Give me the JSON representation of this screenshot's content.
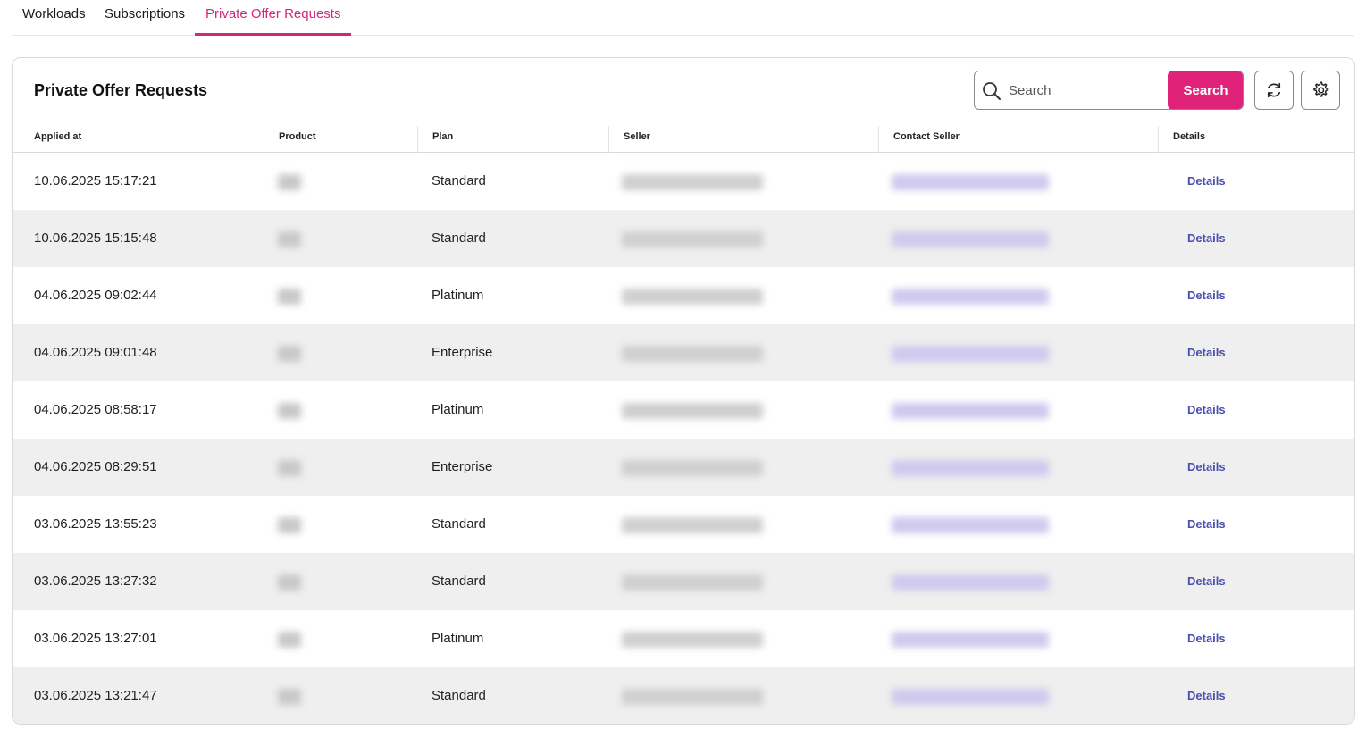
{
  "tabs": [
    {
      "label": "Workloads",
      "active": false
    },
    {
      "label": "Subscriptions",
      "active": false
    },
    {
      "label": "Private Offer Requests",
      "active": true
    }
  ],
  "card": {
    "title": "Private Offer Requests",
    "search": {
      "placeholder": "Search",
      "value": "",
      "button_label": "Search"
    },
    "refresh_icon": "refresh-icon",
    "settings_icon": "gear-icon"
  },
  "colors": {
    "accent": "#e0227a",
    "active_tab": "#d6257d",
    "link": "#4a4fb0",
    "row_alt": "#efefef"
  },
  "table": {
    "columns": [
      "Applied at",
      "Product",
      "Plan",
      "Seller",
      "Contact Seller",
      "Details"
    ],
    "rows": [
      {
        "applied_at": "10.06.2025 15:17:21",
        "plan": "Standard",
        "details": "Details"
      },
      {
        "applied_at": "10.06.2025 15:15:48",
        "plan": "Standard",
        "details": "Details"
      },
      {
        "applied_at": "04.06.2025 09:02:44",
        "plan": "Platinum",
        "details": "Details"
      },
      {
        "applied_at": "04.06.2025 09:01:48",
        "plan": "Enterprise",
        "details": "Details"
      },
      {
        "applied_at": "04.06.2025 08:58:17",
        "plan": "Platinum",
        "details": "Details"
      },
      {
        "applied_at": "04.06.2025 08:29:51",
        "plan": "Enterprise",
        "details": "Details"
      },
      {
        "applied_at": "03.06.2025 13:55:23",
        "plan": "Standard",
        "details": "Details"
      },
      {
        "applied_at": "03.06.2025 13:27:32",
        "plan": "Standard",
        "details": "Details"
      },
      {
        "applied_at": "03.06.2025 13:27:01",
        "plan": "Platinum",
        "details": "Details"
      },
      {
        "applied_at": "03.06.2025 13:21:47",
        "plan": "Standard",
        "details": "Details"
      }
    ]
  }
}
